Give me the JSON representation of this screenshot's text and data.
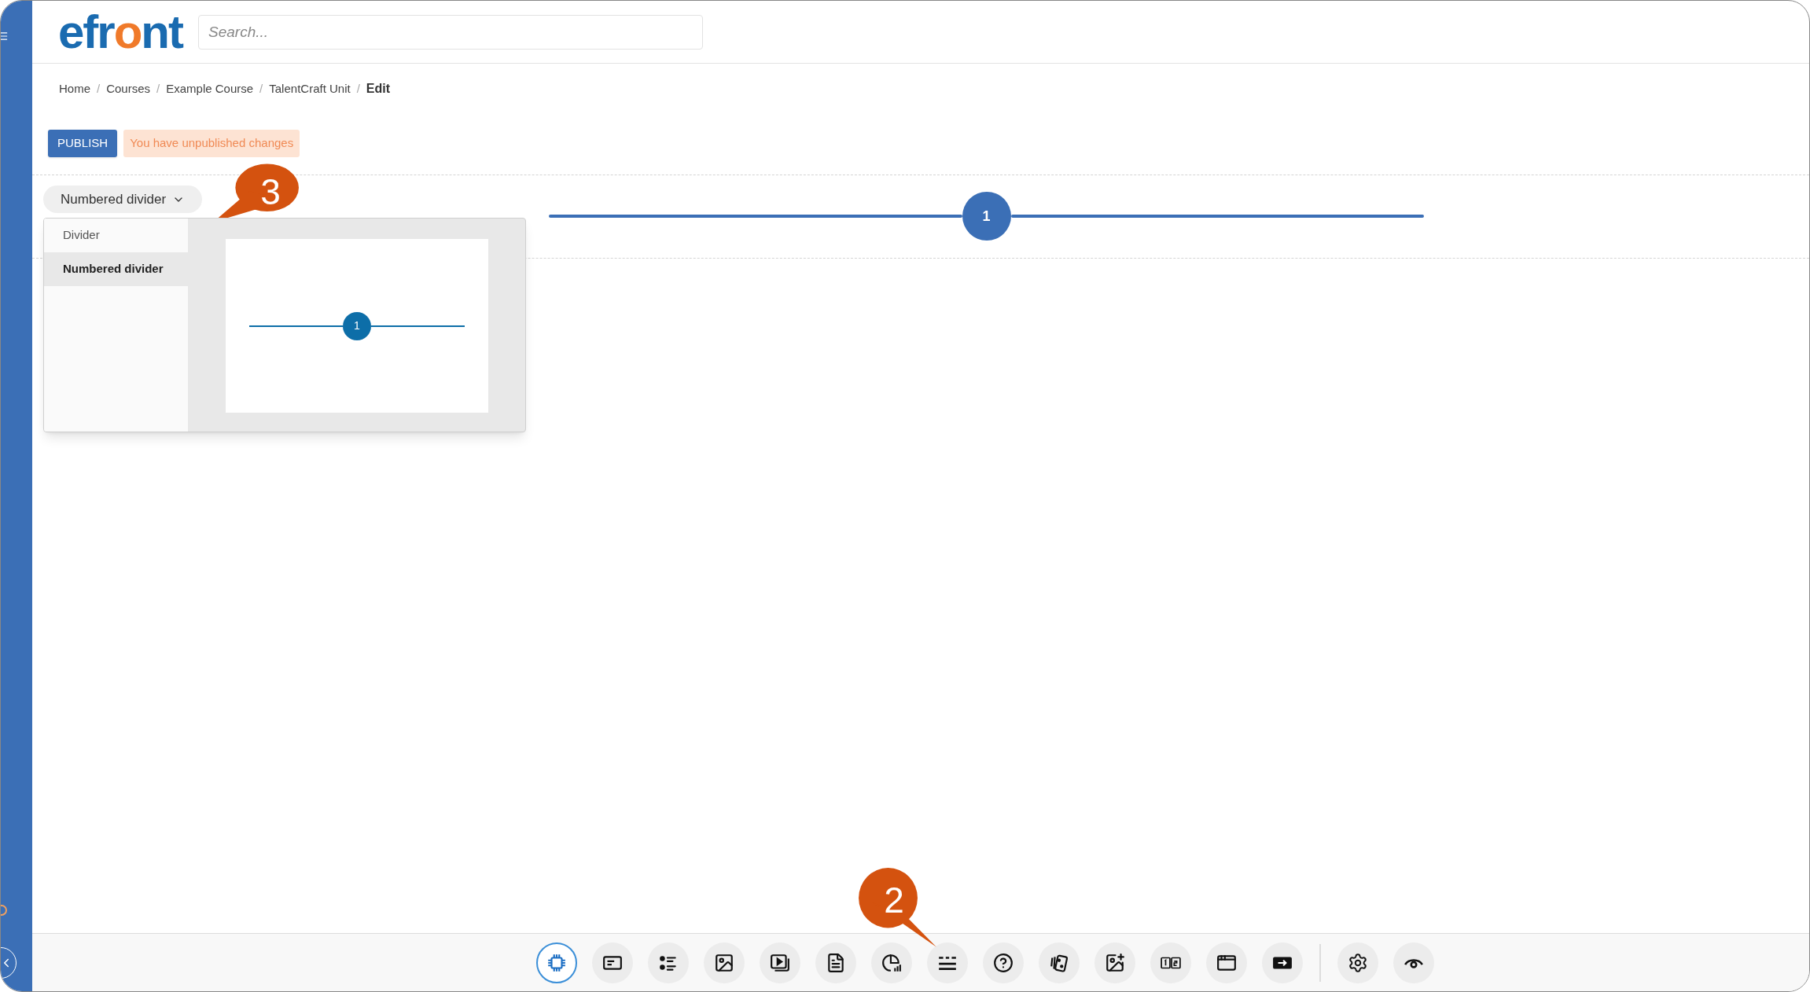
{
  "logo": {
    "parts": [
      {
        "text": "efr",
        "accent": false
      },
      {
        "text": "o",
        "accent": true
      },
      {
        "text": "nt",
        "accent": false
      }
    ]
  },
  "search": {
    "placeholder": "Search..."
  },
  "breadcrumb": [
    {
      "label": "Home",
      "selected": false
    },
    {
      "label": "Courses",
      "selected": false
    },
    {
      "label": "Example Course",
      "selected": false
    },
    {
      "label": "TalentCraft Unit",
      "selected": false
    },
    {
      "label": "Edit",
      "selected": true
    }
  ],
  "breadcrumb_separator": "/",
  "publish_button": "PUBLISH",
  "notice": "You have unpublished changes",
  "divider_picker": {
    "value": "Numbered divider",
    "expanded": true,
    "options": [
      {
        "label": "Divider",
        "selected": false
      },
      {
        "label": "Numbered divider",
        "selected": true
      }
    ],
    "preview_number": "1"
  },
  "canvas_divider": {
    "number": "1"
  },
  "toolbar": {
    "tools": [
      {
        "kind": "ai"
      },
      {
        "kind": "text"
      },
      {
        "kind": "list"
      },
      {
        "kind": "image"
      },
      {
        "kind": "video"
      },
      {
        "kind": "document"
      },
      {
        "kind": "chart"
      },
      {
        "kind": "divider"
      },
      {
        "kind": "question"
      },
      {
        "kind": "cards"
      },
      {
        "kind": "image-add"
      },
      {
        "kind": "steps"
      },
      {
        "kind": "window"
      },
      {
        "kind": "embed"
      }
    ],
    "actions": [
      {
        "kind": "settings"
      },
      {
        "kind": "preview"
      }
    ]
  },
  "callouts": [
    {
      "number": "3"
    },
    {
      "number": "2"
    }
  ]
}
